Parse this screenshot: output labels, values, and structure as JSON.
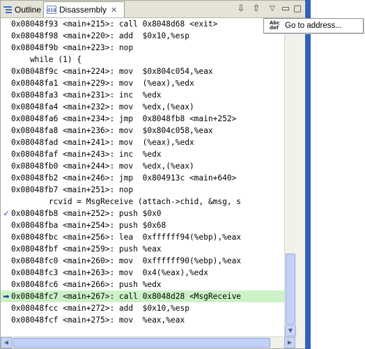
{
  "tabs": [
    {
      "label": "Outline",
      "icon": "outline-icon"
    },
    {
      "label": "Disassembly",
      "icon": "disassembly-icon",
      "close": "✕",
      "active": true
    }
  ],
  "toolbar": {
    "down_arrow": "⇩",
    "up_arrow": "⇧",
    "view_menu": "▽",
    "minimize": "▭",
    "maximize": "▢"
  },
  "menu": {
    "items": [
      {
        "label": "Go to address...",
        "icon": "abc-def-icon"
      }
    ]
  },
  "code_lines": [
    {
      "text": "0x08048f93 <main+215>: call 0x8048d68 <exit>"
    },
    {
      "text": "0x08048f98 <main+220>: add  $0x10,%esp"
    },
    {
      "text": "0x08048f9b <main+223>: nop"
    },
    {
      "text": "    while (1) {"
    },
    {
      "text": "0x08048f9c <main+224>: mov  $0x804c054,%eax"
    },
    {
      "text": "0x08048fa1 <main+229>: mov  (%eax),%edx"
    },
    {
      "text": "0x08048fa3 <main+231>: inc  %edx"
    },
    {
      "text": "0x08048fa4 <main+232>: mov  %edx,(%eax)"
    },
    {
      "text": "0x08048fa6 <main+234>: jmp  0x8048fb8 <main+252>"
    },
    {
      "text": "0x08048fa8 <main+236>: mov  $0x804c058,%eax"
    },
    {
      "text": "0x08048fad <main+241>: mov  (%eax),%edx"
    },
    {
      "text": "0x08048faf <main+243>: inc  %edx"
    },
    {
      "text": "0x08048fb0 <main+244>: mov  %edx,(%eax)"
    },
    {
      "text": "0x08048fb2 <main+246>: jmp  0x804913c <main+640>"
    },
    {
      "text": "0x08048fb7 <main+251>: nop"
    },
    {
      "text": "        rcvid = MsgReceive (attach->chid, &msg, s"
    },
    {
      "text": "0x08048fb8 <main+252>: push $0x0",
      "marker": "breakpoint"
    },
    {
      "text": "0x08048fba <main+254>: push $0x68"
    },
    {
      "text": "0x08048fbc <main+256>: lea  0xffffff94(%ebp),%eax"
    },
    {
      "text": "0x08048fbf <main+259>: push %eax"
    },
    {
      "text": "0x08048fc0 <main+260>: mov  0xffffff90(%ebp),%eax"
    },
    {
      "text": "0x08048fc3 <main+263>: mov  0x4(%eax),%edx"
    },
    {
      "text": "0x08048fc6 <main+266>: push %edx"
    },
    {
      "text": "0x08048fc7 <main+267>: call 0x8048d28 <MsgReceive",
      "marker": "current",
      "current": true
    },
    {
      "text": "0x08048fcc <main+272>: add  $0x10,%esp"
    },
    {
      "text": "0x08048fcf <main+275>: mov  %eax,%eax"
    }
  ],
  "markers": {
    "breakpoint": "✓",
    "current": "➡"
  },
  "scroll": {
    "up": "▲",
    "down": "▼",
    "left": "◀",
    "right": "▶"
  }
}
